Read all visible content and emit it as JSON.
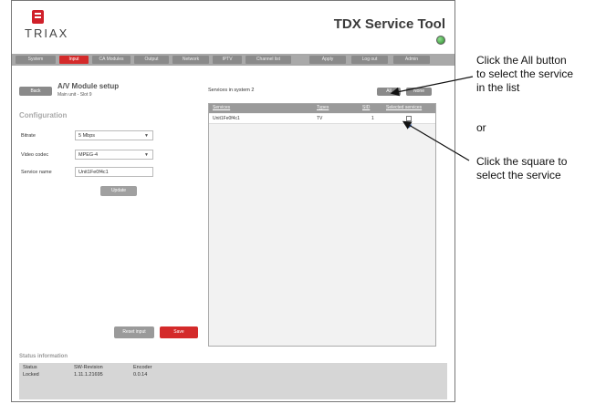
{
  "header": {
    "brand": "TRIAX",
    "title": "TDX Service Tool"
  },
  "tabs": [
    {
      "label": "System",
      "active": false
    },
    {
      "label": "Input",
      "active": true
    },
    {
      "label": "CA Modules",
      "active": false
    },
    {
      "label": "Output",
      "active": false
    },
    {
      "label": "Network",
      "active": false
    },
    {
      "label": "IPTV",
      "active": false
    },
    {
      "label": "Channel list",
      "active": false
    },
    {
      "label": "Apply",
      "active": false
    },
    {
      "label": "Log out",
      "active": false
    },
    {
      "label": "Admin",
      "active": false
    }
  ],
  "module": {
    "back_label": "Back",
    "title": "A/V Module setup",
    "subtitle": "Main unit - Slot 9"
  },
  "configuration": {
    "heading": "Configuration",
    "bitrate": {
      "label": "Bitrate",
      "value": "5 Mbps"
    },
    "video_codec": {
      "label": "Video codec",
      "value": "MPEG-4"
    },
    "service_name": {
      "label": "Service name",
      "value": "Unit1Fe0f4c1"
    },
    "update_label": "Update",
    "reset_label": "Reset input",
    "save_label": "Save"
  },
  "services": {
    "title": "Services in system 2",
    "all_label": "All",
    "none_label": "None",
    "columns": [
      "Services",
      "Types",
      "SID",
      "Selected services"
    ],
    "rows": [
      {
        "service": "Unit1Fe0f4c1",
        "type": "TV",
        "sid": "1",
        "selected": true
      }
    ]
  },
  "status": {
    "heading": "Status information",
    "columns": [
      "Status",
      "SW-Revision",
      "Encoder"
    ],
    "values": [
      "Locked",
      "1.11.1.21695",
      "0.0.14"
    ]
  },
  "annotations": {
    "all_button": [
      "Click the All button",
      "to select the service",
      "in the list"
    ],
    "or": "or",
    "square": [
      "Click the square to",
      "select the service"
    ]
  },
  "colors": {
    "accent": "#d42a2a",
    "tab_bg": "#8a8a8a",
    "led": "#2c8a2c"
  }
}
